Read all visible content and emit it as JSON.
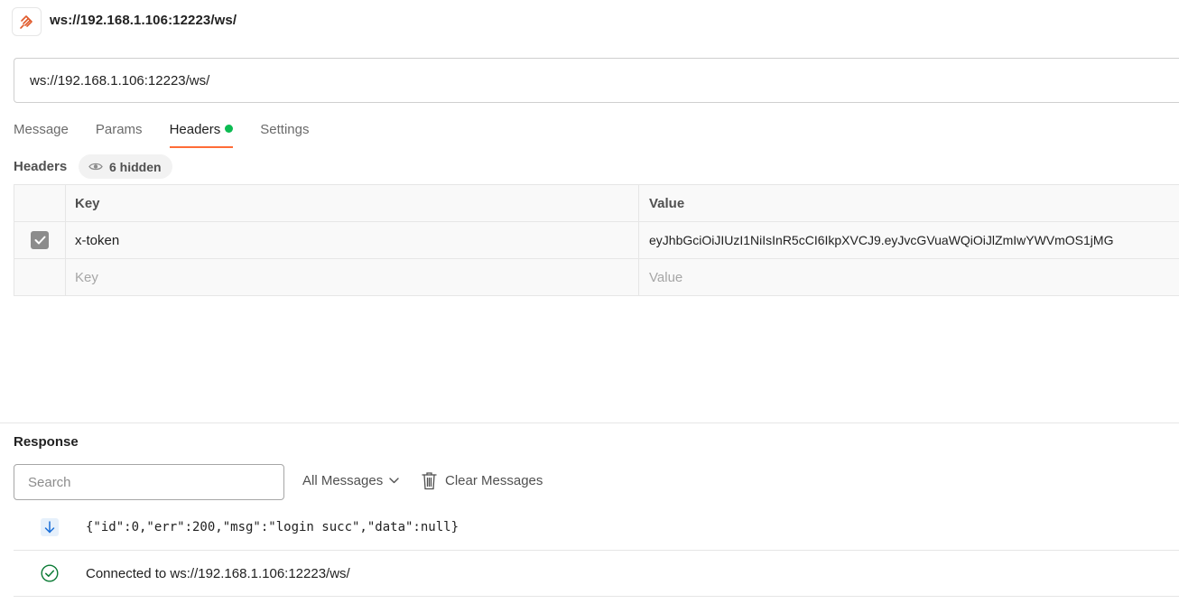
{
  "window": {
    "title": "ws://192.168.1.106:12223/ws/",
    "app_icon": "websocket-request-icon"
  },
  "url_bar": {
    "value": "ws://192.168.1.106:12223/ws/"
  },
  "tabs": [
    {
      "label": "Message",
      "active": false
    },
    {
      "label": "Params",
      "active": false
    },
    {
      "label": "Headers",
      "active": true,
      "indicator_color": "#0cbb52"
    },
    {
      "label": "Settings",
      "active": false
    }
  ],
  "headers_section": {
    "label": "Headers",
    "hidden_badge": "6 hidden",
    "table": {
      "columns": [
        "Key",
        "Value"
      ],
      "rows": [
        {
          "checked": true,
          "key": "x-token",
          "value": "eyJhbGciOiJIUzI1NiIsInR5cCI6IkpXVCJ9.eyJvcGVuaWQiOiJlZmIwYWVmOS1jMG"
        }
      ],
      "placeholder": {
        "key": "Key",
        "value": "Value"
      }
    }
  },
  "response": {
    "title": "Response",
    "search_placeholder": "Search",
    "filter_label": "All Messages",
    "clear_label": "Clear Messages",
    "messages": [
      {
        "icon": "arrow-down-icon",
        "text": "{\"id\":0,\"err\":200,\"msg\":\"login succ\",\"data\":null}"
      },
      {
        "icon": "check-circle-icon",
        "text": "Connected to ws://192.168.1.106:12223/ws/"
      }
    ]
  },
  "colors": {
    "accent": "#ff6c37",
    "success": "#0cbb52",
    "connected": "#0a7a34",
    "incoming": "#1a6ed8"
  }
}
